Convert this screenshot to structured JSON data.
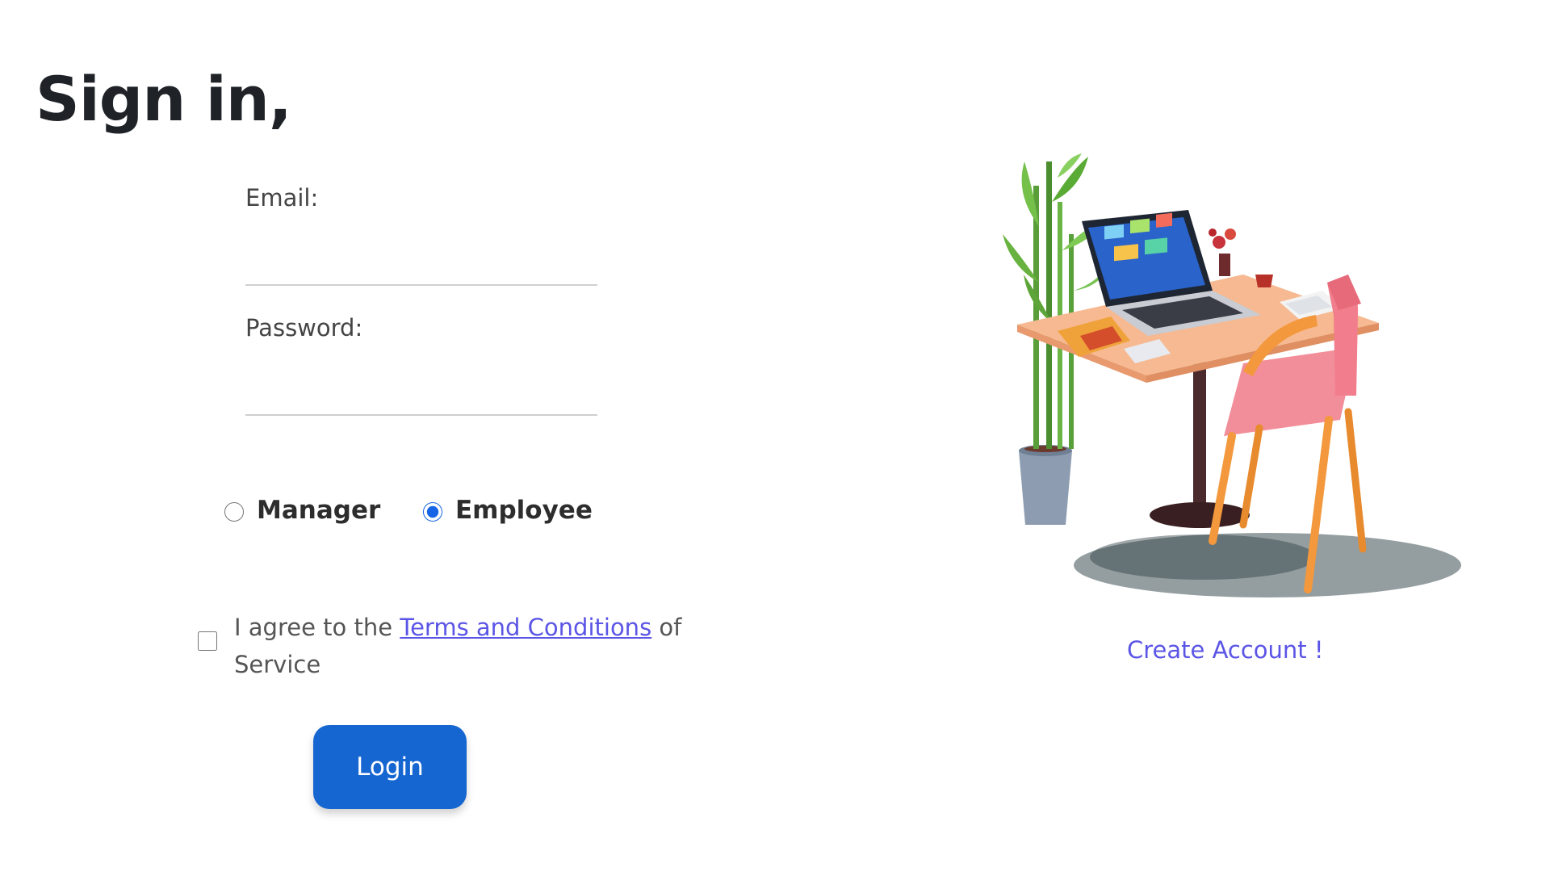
{
  "title": "Sign in,",
  "form": {
    "email_label": "Email:",
    "email_value": "",
    "password_label": "Password:",
    "password_value": "",
    "roles": [
      {
        "label": "Manager",
        "selected": false
      },
      {
        "label": "Employee",
        "selected": true
      }
    ],
    "terms": {
      "checked": false,
      "prefix": "I agree to the ",
      "link_text": "Terms and Conditions",
      "suffix": " of Service"
    },
    "login_label": "Login"
  },
  "side": {
    "illustration_icon": "desk-with-laptop-and-chair-illustration",
    "create_account_label": "Create Account !"
  },
  "colors": {
    "accent": "#1666d2",
    "link": "#5b55e6"
  }
}
